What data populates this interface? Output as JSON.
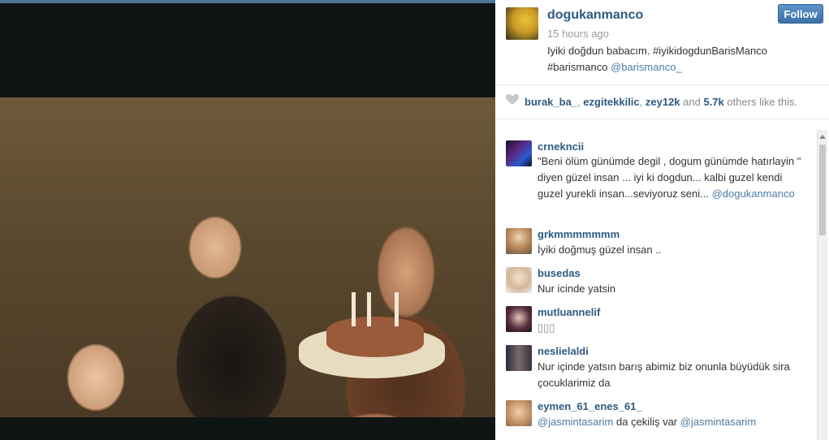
{
  "post": {
    "username": "dogukanmanco",
    "time_ago": "15 hours ago",
    "caption_text": "Iyiki doğdun babacım. #iyikidogdunBarisManco #barismanco",
    "caption_mention": "@barismanco_",
    "follow_label": "Follow"
  },
  "likes": {
    "liker1": "burak_ba_",
    "sep1": ", ",
    "liker2": "ezgitekkilic",
    "sep2": ", ",
    "liker3": "zey12k",
    "and": " and ",
    "count": "5.7k",
    "suffix": " others like this."
  },
  "comments": [
    {
      "user": "crnekncii",
      "text": "\"Beni ölüm günümde degil , dogum günümde hatırlayin \" diyen güzel insan ... iyi ki dogdun... kalbi guzel kendi guzel yurekli insan...seviyoruz seni...",
      "mention": "@dogukanmanco"
    },
    {
      "user": "grkmmmmmmm",
      "text": "İyiki doğmuş güzel insan .."
    },
    {
      "user": "busedas",
      "text": "Nur icinde yatsin"
    },
    {
      "user": "mutluannelif",
      "text": "▯▯▯"
    },
    {
      "user": "neslielaldi",
      "text": "Nur içinde yatsın barış abimiz biz onunla büyüdük sira çocuklarimiz da"
    },
    {
      "user": "eymen_61_enes_61_",
      "mention1": "@jasmintasarim",
      "text": " da çekiliş var ",
      "mention2": "@jasmintasarim"
    }
  ],
  "colors": {
    "link": "#2d5b82",
    "mention": "#4c7ba4",
    "follow_bg": "#3b72a8"
  }
}
